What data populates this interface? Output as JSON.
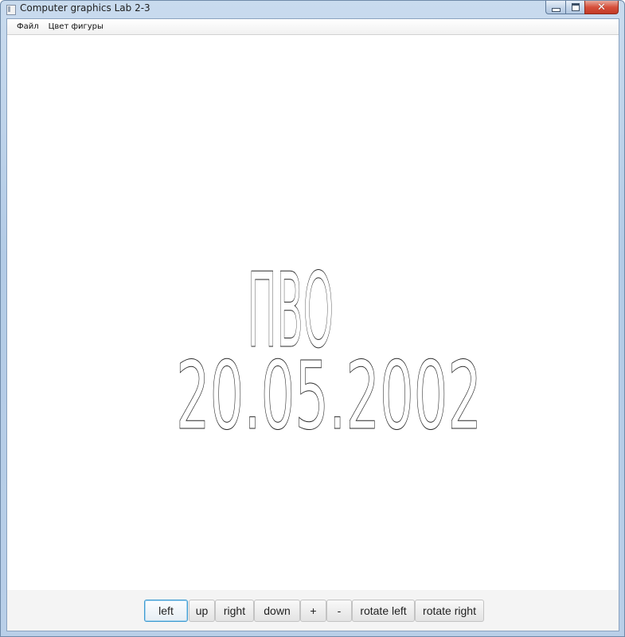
{
  "window": {
    "title": "Computer graphics Lab 2-3",
    "controls": {
      "minimize_icon": "minimize-icon",
      "maximize_icon": "maximize-icon",
      "close_icon": "close-icon",
      "close_glyph": "✕"
    }
  },
  "menubar": {
    "items": [
      {
        "label": "Файл"
      },
      {
        "label": "Цвет фигуры"
      }
    ]
  },
  "canvas": {
    "line1": "ПВО",
    "line2": "20.05.2002",
    "stroke_color": "#2a2a2a",
    "fill_color": "none"
  },
  "toolbar": {
    "buttons": [
      {
        "label": "left",
        "focused": true
      },
      {
        "label": "up"
      },
      {
        "label": "right"
      },
      {
        "label": "down"
      },
      {
        "label": "+"
      },
      {
        "label": "-"
      },
      {
        "label": "rotate left"
      },
      {
        "label": "rotate right"
      }
    ]
  },
  "colors": {
    "window_frame": "#b3cbe6",
    "close_button": "#c94530",
    "toolbar_background": "#f4f4f4",
    "focus_border": "#3e9bd1"
  }
}
